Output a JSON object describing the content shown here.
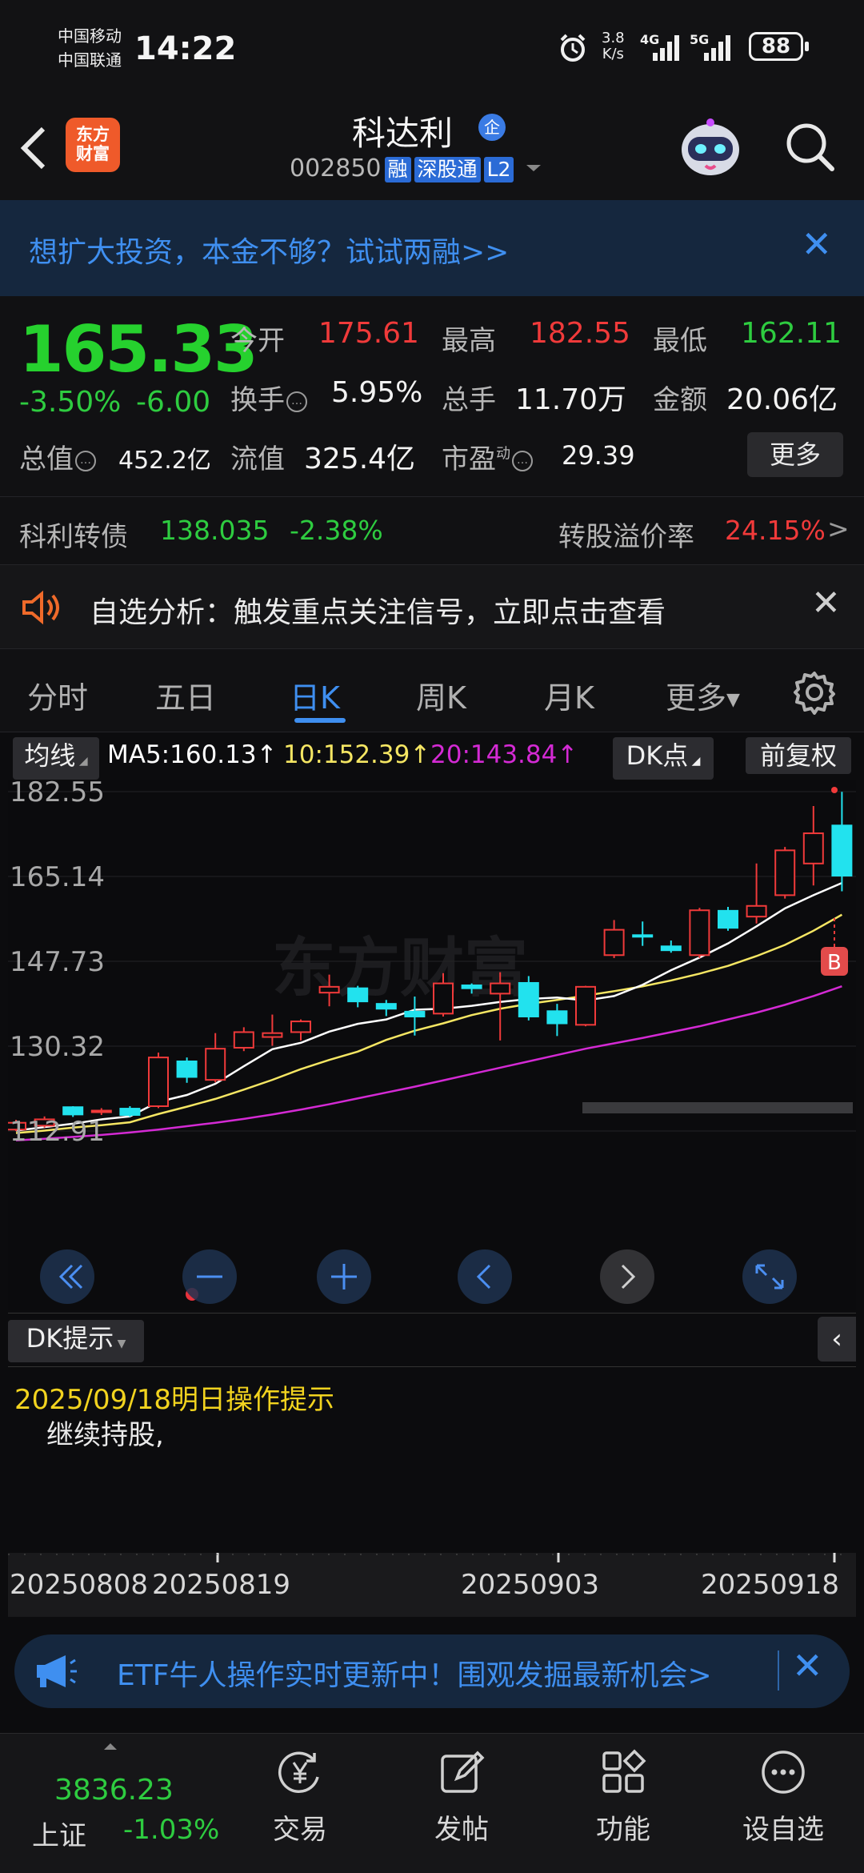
{
  "status_bar": {
    "carrier1": "中国移动",
    "carrier2": "中国联通",
    "time": "14:22",
    "net_speed_value": "3.8",
    "net_speed_unit": "K/s",
    "net1": "4G",
    "net2": "5G",
    "battery": "88"
  },
  "header": {
    "logo_line1": "东方",
    "logo_line2": "财富",
    "stock_name": "科达利",
    "badge_qiye": "企",
    "stock_code": "002850",
    "tags": [
      "融",
      "深股通",
      "L2"
    ]
  },
  "promo_banner": {
    "text": "想扩大投资，本金不够？试试两融>>"
  },
  "quote": {
    "price": "165.33",
    "change_pct": "-3.50%",
    "change": "-6.00",
    "open_label": "今开",
    "open": "175.61",
    "high_label": "最高",
    "high": "182.55",
    "low_label": "最低",
    "low": "162.11",
    "turnover_label": "换手",
    "turnover": "5.95%",
    "volume_label": "总手",
    "volume": "11.70万",
    "amount_label": "金额",
    "amount": "20.06亿",
    "mktcap_label": "总值",
    "mktcap": "452.2亿",
    "float_label": "流值",
    "float_cap": "325.4亿",
    "pe_label": "市盈",
    "pe_sup": "动",
    "pe": "29.39",
    "more_button": "更多"
  },
  "bond": {
    "name": "科利转债",
    "price": "138.035",
    "change": "-2.38%",
    "premium_label": "转股溢价率",
    "premium": "24.15%",
    "arrow": ">"
  },
  "notice": {
    "text": "自选分析：触发重点关注信号，立即点击查看"
  },
  "tabs": {
    "items": [
      "分时",
      "五日",
      "日K",
      "周K",
      "月K",
      "更多"
    ],
    "active": "日K"
  },
  "ma_row": {
    "indicator": "均线",
    "ma5": "MA5:160.13↑",
    "ma10": "10:152.39↑",
    "ma20": "20:143.84↑",
    "dk_button": "DK点",
    "adjust_button": "前复权"
  },
  "colors": {
    "up": "#f03a3a",
    "down": "#22e2ee",
    "ma5": "#ffffff",
    "ma10": "#f5e663",
    "ma20": "#d42ad4",
    "accent": "#3f8ff0"
  },
  "chart_data": {
    "type": "candlestick",
    "y_tick_labels": [
      "182.55",
      "165.14",
      "147.73",
      "130.32",
      "112.91"
    ],
    "ylim": [
      112.91,
      182.55
    ],
    "x_tick_labels": [
      "20250808",
      "20250819",
      "20250903",
      "20250918"
    ],
    "watermark": "东方财富",
    "signal_marker": "B",
    "candles": [
      {
        "o": 113.2,
        "c": 114.6,
        "h": 115.2,
        "l": 112.9
      },
      {
        "o": 114.0,
        "c": 115.3,
        "h": 115.9,
        "l": 113.6
      },
      {
        "o": 117.8,
        "c": 116.3,
        "h": 118.0,
        "l": 115.8
      },
      {
        "o": 116.8,
        "c": 117.1,
        "h": 117.6,
        "l": 116.2
      },
      {
        "o": 117.5,
        "c": 116.2,
        "h": 118.0,
        "l": 115.8
      },
      {
        "o": 118.0,
        "c": 128.0,
        "h": 129.0,
        "l": 117.6
      },
      {
        "o": 127.2,
        "c": 124.0,
        "h": 128.0,
        "l": 122.8
      },
      {
        "o": 123.4,
        "c": 129.8,
        "h": 133.0,
        "l": 122.9
      },
      {
        "o": 130.0,
        "c": 133.2,
        "h": 134.2,
        "l": 129.3
      },
      {
        "o": 132.2,
        "c": 133.0,
        "h": 136.8,
        "l": 130.4
      },
      {
        "o": 133.2,
        "c": 135.4,
        "h": 135.8,
        "l": 131.5
      },
      {
        "o": 141.3,
        "c": 142.5,
        "h": 145.0,
        "l": 138.5
      },
      {
        "o": 142.2,
        "c": 139.5,
        "h": 142.7,
        "l": 138.3
      },
      {
        "o": 139.0,
        "c": 138.0,
        "h": 139.8,
        "l": 136.5
      },
      {
        "o": 137.4,
        "c": 136.4,
        "h": 140.5,
        "l": 132.5
      },
      {
        "o": 137.0,
        "c": 143.2,
        "h": 145.3,
        "l": 136.4
      },
      {
        "o": 142.8,
        "c": 142.2,
        "h": 143.2,
        "l": 141.1
      },
      {
        "o": 141.1,
        "c": 143.2,
        "h": 145.5,
        "l": 131.5
      },
      {
        "o": 143.3,
        "c": 136.4,
        "h": 144.7,
        "l": 135.6
      },
      {
        "o": 137.5,
        "c": 135.0,
        "h": 139.0,
        "l": 132.4
      },
      {
        "o": 134.7,
        "c": 142.5,
        "h": 142.7,
        "l": 134.4
      },
      {
        "o": 149.0,
        "c": 154.2,
        "h": 156.2,
        "l": 148.4
      },
      {
        "o": 153.1,
        "c": 152.8,
        "h": 155.9,
        "l": 150.9
      },
      {
        "o": 150.8,
        "c": 150.0,
        "h": 152.0,
        "l": 149.5
      },
      {
        "o": 149.0,
        "c": 158.2,
        "h": 158.7,
        "l": 148.4
      },
      {
        "o": 158.1,
        "c": 154.6,
        "h": 158.9,
        "l": 154.0
      },
      {
        "o": 156.9,
        "c": 159.1,
        "h": 167.8,
        "l": 155.5
      },
      {
        "o": 161.3,
        "c": 170.5,
        "h": 171.2,
        "l": 160.6
      },
      {
        "o": 167.8,
        "c": 174.0,
        "h": 179.6,
        "l": 163.3
      },
      {
        "o": 175.6,
        "c": 165.3,
        "h": 182.5,
        "l": 162.1
      }
    ],
    "ma5": [
      113.0,
      113.7,
      114.4,
      115.3,
      115.9,
      118.9,
      120.3,
      122.6,
      126.2,
      129.7,
      131.0,
      133.3,
      134.9,
      135.8,
      137.8,
      138.0,
      138.6,
      139.4,
      140.0,
      140.3,
      139.7,
      140.6,
      142.9,
      145.9,
      148.5,
      151.4,
      154.9,
      158.6,
      161.3,
      163.8
    ],
    "ma10": [
      112.5,
      113.0,
      113.6,
      114.1,
      114.7,
      116.4,
      117.9,
      119.5,
      121.4,
      123.4,
      125.6,
      127.5,
      129.2,
      131.6,
      133.5,
      135.0,
      136.7,
      138.0,
      139.0,
      139.8,
      140.7,
      141.6,
      142.6,
      143.8,
      145.2,
      146.8,
      148.8,
      151.1,
      154.0,
      157.3
    ],
    "ma20": [
      111.0,
      111.3,
      111.7,
      112.1,
      112.6,
      113.2,
      113.9,
      114.6,
      115.4,
      116.3,
      117.3,
      118.4,
      119.6,
      120.8,
      122.0,
      123.3,
      124.6,
      125.9,
      127.2,
      128.5,
      129.8,
      130.9,
      132.0,
      133.2,
      134.4,
      135.8,
      137.2,
      138.8,
      140.6,
      142.6
    ]
  },
  "dk_panel": {
    "title": "DK提示",
    "date_line": "2025/09/18明日操作提示",
    "body": "继续持股,"
  },
  "etf_banner": {
    "text": "ETF牛人操作实时更新中！围观发掘最新机会>"
  },
  "bottom_nav": {
    "index_value": "3836.23",
    "index_name": "上证",
    "index_change": "-1.03%",
    "items": [
      "交易",
      "发帖",
      "功能",
      "设自选"
    ]
  }
}
